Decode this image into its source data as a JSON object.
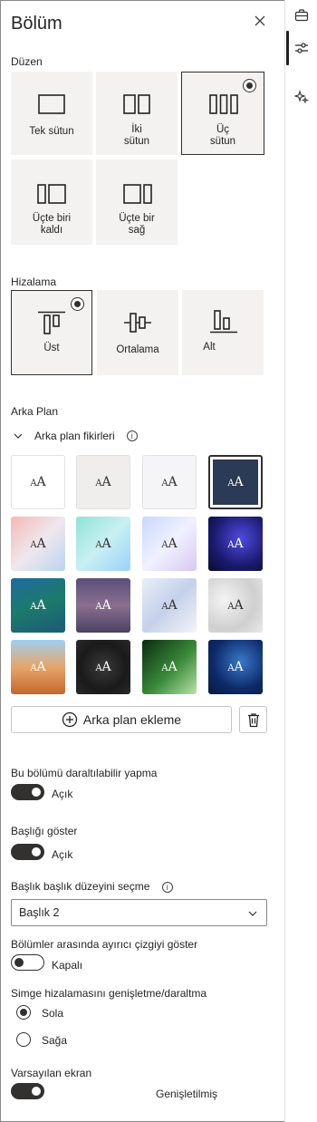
{
  "panel": {
    "title": "Bölüm"
  },
  "layout": {
    "label": "Düzen",
    "options": [
      {
        "label": "Tek sütun",
        "selected": false
      },
      {
        "label": "İki\nsütun",
        "selected": false
      },
      {
        "label": "Üç\nsütun",
        "selected": true
      },
      {
        "label": "Üçte biri\nkaldı",
        "selected": false
      },
      {
        "label": "Üçte bir\nsağ",
        "selected": false
      }
    ]
  },
  "alignment": {
    "label": "Hizalama",
    "options": [
      {
        "label": "Üst",
        "selected": true
      },
      {
        "label": "Ortalama",
        "selected": false
      },
      {
        "label": "Alt",
        "selected": false
      }
    ]
  },
  "background": {
    "label": "Arka Plan",
    "ideas_label": "Arka plan fikirleri",
    "tile_text": "A",
    "tile_text_small": "A",
    "add_label": "Arka plan ekleme",
    "tiles": [
      {
        "fill": "#ffffff",
        "border": "#e1e1e1",
        "dark": false
      },
      {
        "fill": "#efeeed",
        "border": "#e1e1e1",
        "dark": false
      },
      {
        "fill": "#f5f5f7",
        "border": "#e1e1e1",
        "dark": false
      },
      {
        "fill": "#2b3a55",
        "border": "#323130",
        "dark": true,
        "selected": true
      },
      {
        "fill": "linear-gradient(135deg,#f2b8b3,#f0e7ee,#b9d4f0)",
        "dark": false
      },
      {
        "fill": "linear-gradient(135deg,#8fe3d5,#c8f0f3,#9dd0f7)",
        "dark": false
      },
      {
        "fill": "linear-gradient(135deg,#c8d8fb,#f0f0ff,#d8c8f2)",
        "dark": false
      },
      {
        "fill": "radial-gradient(circle at 60% 40%,#4f4be0,#1a1a6e 60%,#0b0b2e)",
        "dark": true
      },
      {
        "fill": "linear-gradient(160deg,#1f6aa0,#1c7a6a,#1c5a7a)",
        "dark": true
      },
      {
        "fill": "linear-gradient(180deg,#5b4f7a,#8a6f8f,#4a4264)",
        "dark": true
      },
      {
        "fill": "linear-gradient(135deg,#e9eef8,#c5d0ea,#f4f4f8)",
        "dark": false
      },
      {
        "fill": "radial-gradient(circle at 30% 40%,#f4f4f4,#cfcfcf 60%,#e8e8e8)",
        "dark": false
      },
      {
        "fill": "linear-gradient(180deg,#9fd0ee,#e6a56a,#c4682f)",
        "dark": true
      },
      {
        "fill": "radial-gradient(circle at 50% 50%,#3a3a3a,#1a1a1a 60%,#2a2a2a)",
        "dark": true
      },
      {
        "fill": "linear-gradient(135deg,#0b2a12,#3a8a3a 55%,#b8e3a8)",
        "dark": true
      },
      {
        "fill": "radial-gradient(circle at 60% 40%,#3a78c8,#0d2a6a 60%,#071a3e)",
        "dark": true
      }
    ]
  },
  "collapsible": {
    "label": "Bu bölümü daraltılabilir yapma",
    "toggle_text": "Açık",
    "on": true
  },
  "show_heading": {
    "label": "Başlığı göster",
    "toggle_text": "Açık",
    "on": true
  },
  "heading_level": {
    "label": "Başlık başlık düzeyini seçme",
    "value": "Başlık 2"
  },
  "divider": {
    "label": "Bölümler arasında ayırıcı çizgiyi göster",
    "toggle_text": "Kapalı",
    "on": false
  },
  "icon_alignment": {
    "label": "Simge hizalamasını genişletme/daraltma",
    "options": [
      {
        "label": "Sola",
        "checked": true
      },
      {
        "label": "Sağa",
        "checked": false
      }
    ]
  },
  "default_display": {
    "label": "Varsayılan ekran",
    "toggle_text": "Genişletilmiş",
    "on": true
  },
  "colors": {
    "accent": "#323130",
    "tile_bg": "#f3f2f1",
    "border": "#c8c6c4"
  },
  "icons": [
    "close-icon",
    "briefcase-icon",
    "sliders-icon",
    "sparkle-icon",
    "chevron-down-icon",
    "info-icon",
    "add-circle-icon",
    "trash-icon"
  ]
}
